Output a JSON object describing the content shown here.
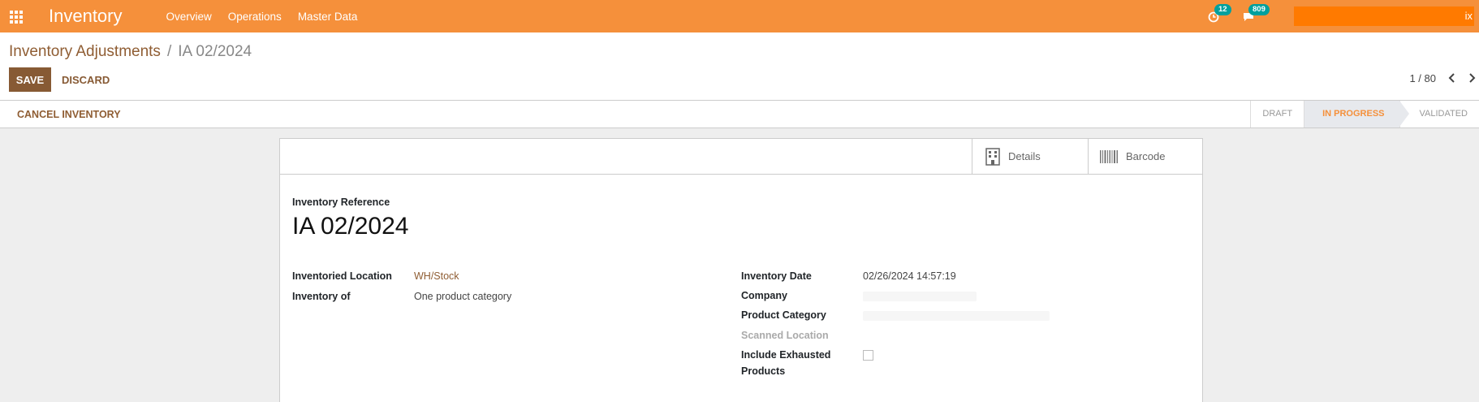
{
  "navbar": {
    "app_title": "Inventory",
    "menu": [
      "Overview",
      "Operations",
      "Master Data"
    ],
    "activity_count": "12",
    "message_count": "809",
    "user_suffix": "ix"
  },
  "breadcrumb": {
    "parent": "Inventory Adjustments",
    "current": "IA 02/2024"
  },
  "actions": {
    "save_label": "SAVE",
    "discard_label": "DISCARD"
  },
  "pager": {
    "text": "1 / 80"
  },
  "statusbar": {
    "cancel_label": "CANCEL INVENTORY",
    "stages": [
      "DRAFT",
      "IN PROGRESS",
      "VALIDATED"
    ],
    "active_stage": "IN PROGRESS"
  },
  "smart_buttons": {
    "details": "Details",
    "barcode": "Barcode"
  },
  "form": {
    "reference_label": "Inventory Reference",
    "reference_value": "IA 02/2024",
    "inventoried_location_label": "Inventoried Location",
    "inventoried_location_value": "WH/Stock",
    "inventory_of_label": "Inventory of",
    "inventory_of_value": "One product category",
    "inventory_date_label": "Inventory Date",
    "inventory_date_value": "02/26/2024 14:57:19",
    "company_label": "Company",
    "product_category_label": "Product Category",
    "scanned_location_label": "Scanned Location",
    "include_exhausted_label_1": "Include Exhausted",
    "include_exhausted_label_2": "Products",
    "include_exhausted_checked": false
  },
  "colors": {
    "navbar": "#f5903b",
    "primary": "#875a34",
    "link": "#8f5d33",
    "badge": "#00a09d"
  }
}
